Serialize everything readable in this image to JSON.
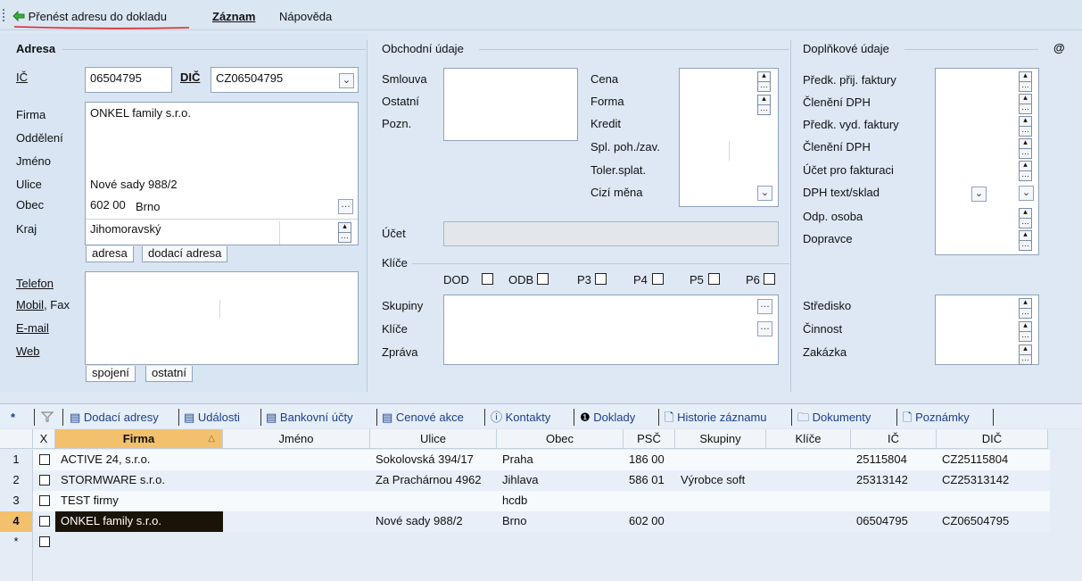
{
  "toolbar": {
    "transfer_label": "Přenést adresu do dokladu",
    "record_label": "Záznam",
    "help_label": "Nápověda"
  },
  "address": {
    "title": "Adresa",
    "ico_label": "IČ",
    "ico_value": "06504795",
    "dic_label": "DIČ",
    "dic_value": "CZ06504795",
    "firma_label": "Firma",
    "firma_value": "ONKEL family s.r.o.",
    "oddeleni_label": "Oddělení",
    "jmeno_label": "Jméno",
    "ulice_label": "Ulice",
    "ulice_value": "Nové sady 988/2",
    "obec_label": "Obec",
    "psc_value": "602 00",
    "obec_value": "Brno",
    "kraj_label": "Kraj",
    "kraj_value": "Jihomoravský",
    "subtabs": [
      "adresa",
      "dodací adresa"
    ],
    "telefon_label": "Telefon",
    "mobil_label": "Mobil",
    "fax_label": ", Fax",
    "email_label": "E-mail",
    "web_label": "Web",
    "contact_tabs": [
      "spojení",
      "ostatní"
    ]
  },
  "business": {
    "title": "Obchodní údaje",
    "smlouva_label": "Smlouva",
    "ostatni_label": "Ostatní",
    "pozn_label": "Pozn.",
    "cena_label": "Cena",
    "forma_label": "Forma",
    "kredit_label": "Kredit",
    "splpoh_label": "Spl. poh./zav.",
    "toler_label": "Toler.splat.",
    "cizimena_label": "Cizí měna",
    "ucet_label": "Účet",
    "klice_title": "Klíče",
    "checks": [
      "DOD",
      "ODB",
      "P3",
      "P4",
      "P5",
      "P6"
    ],
    "skupiny_label": "Skupiny",
    "klice_label": "Klíče",
    "zprava_label": "Zpráva"
  },
  "extra": {
    "title": "Doplňkové údaje",
    "at": "@",
    "rows": [
      "Předk. přij. faktury",
      "Členění DPH",
      "Předk. vyd. faktury",
      "Členění DPH",
      "Účet pro fakturaci",
      "DPH text/sklad",
      "Odp. osoba",
      "Dopravce"
    ],
    "rows2": [
      "Středisko",
      "Činnost",
      "Zakázka"
    ]
  },
  "tabs": {
    "star": "*",
    "items": [
      "Dodací adresy",
      "Události",
      "Bankovní účty",
      "Cenové akce",
      "Kontakty",
      "Doklady",
      "Historie záznamu",
      "Dokumenty",
      "Poznámky"
    ]
  },
  "grid": {
    "columns": [
      "X",
      "Firma",
      "Jméno",
      "Ulice",
      "Obec",
      "PSČ",
      "Skupiny",
      "Klíče",
      "IČ",
      "DIČ"
    ],
    "rows": [
      {
        "num": "1",
        "firma": "ACTIVE 24, s.r.o.",
        "jmeno": "",
        "ulice": "Sokolovská 394/17",
        "obec": "Praha",
        "psc": "186 00",
        "skupiny": "",
        "klice": "",
        "ico": "25115804",
        "dic": "CZ25115804"
      },
      {
        "num": "2",
        "firma": "STORMWARE s.r.o.",
        "jmeno": "",
        "ulice": "Za Prachárnou 4962",
        "obec": "Jihlava",
        "psc": "586 01",
        "skupiny": "Výrobce soft",
        "klice": "",
        "ico": "25313142",
        "dic": "CZ25313142"
      },
      {
        "num": "3",
        "firma": "TEST firmy",
        "jmeno": "",
        "ulice": "",
        "obec": "hcdb",
        "psc": "",
        "skupiny": "",
        "klice": "",
        "ico": "",
        "dic": ""
      },
      {
        "num": "4",
        "firma": "ONKEL family s.r.o.",
        "jmeno": "",
        "ulice": "Nové sady 988/2",
        "obec": "Brno",
        "psc": "602 00",
        "skupiny": "",
        "klice": "",
        "ico": "06504795",
        "dic": "CZ06504795"
      }
    ],
    "new_row": "*"
  },
  "colors": {
    "accent_sort": "#f3c06d",
    "selected_row": "#1a1408",
    "red_underline": "#e02020"
  }
}
